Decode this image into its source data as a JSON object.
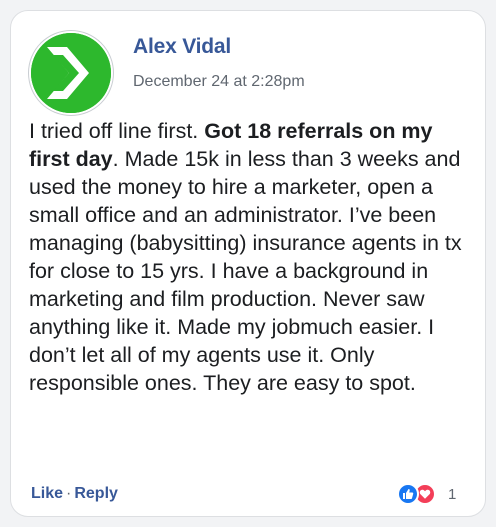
{
  "comment": {
    "author": "Alex Vidal",
    "timestamp": "December 24 at 2:28pm",
    "body": {
      "intro": "I tried off line first. ",
      "highlight": "Got 18 referrals on my first day",
      "rest": ". Made 15k in less than 3 weeks and used the money to hire a marketer, open a small office and an administrator. I’ve been managing (babysitting) insurance agents in tx for close to 15 yrs. I have a background in marketing and film production. Never saw anything like it. Made my jobmuch easier. I don’t let all of my agents use it. Only responsible ones. They are easy to spot."
    },
    "actions": {
      "like": "Like",
      "separator": "·",
      "reply": "Reply"
    },
    "reactions": {
      "icons": [
        "thumbs-up-icon",
        "heart-icon"
      ],
      "count": "1"
    }
  },
  "colors": {
    "avatar_green": "#2db82d",
    "name_blue": "#385898",
    "like_blue": "#1877f2",
    "love_red": "#f33e58",
    "meta_gray": "#606770"
  }
}
